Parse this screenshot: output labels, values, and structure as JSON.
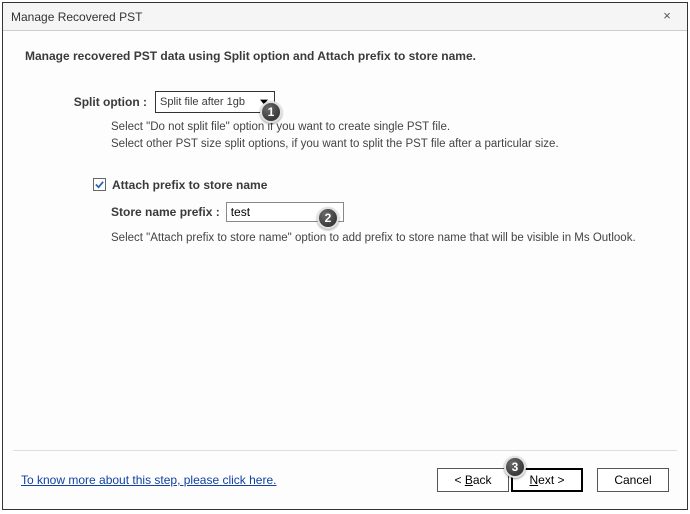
{
  "window": {
    "title": "Manage Recovered PST",
    "close": "×"
  },
  "instruction": "Manage recovered PST data using Split option and Attach prefix to store name.",
  "split": {
    "label": "Split option :",
    "value": "Split file after 1gb",
    "help1": "Select \"Do not split file\" option if you want to create single PST file.",
    "help2": "Select other PST size split options, if you want to split the PST file after a particular size."
  },
  "prefix": {
    "checkbox_label": "Attach prefix to store name",
    "checked": true,
    "input_label": "Store name prefix :",
    "value": "test",
    "help": "Select \"Attach prefix to store name\" option to add prefix to store name that will be visible in Ms Outlook."
  },
  "footer": {
    "help_link": "To know more about this step, please click here.",
    "back": "< Back",
    "next": "Next >",
    "cancel": "Cancel"
  },
  "callouts": {
    "c1": "1",
    "c2": "2",
    "c3": "3"
  }
}
